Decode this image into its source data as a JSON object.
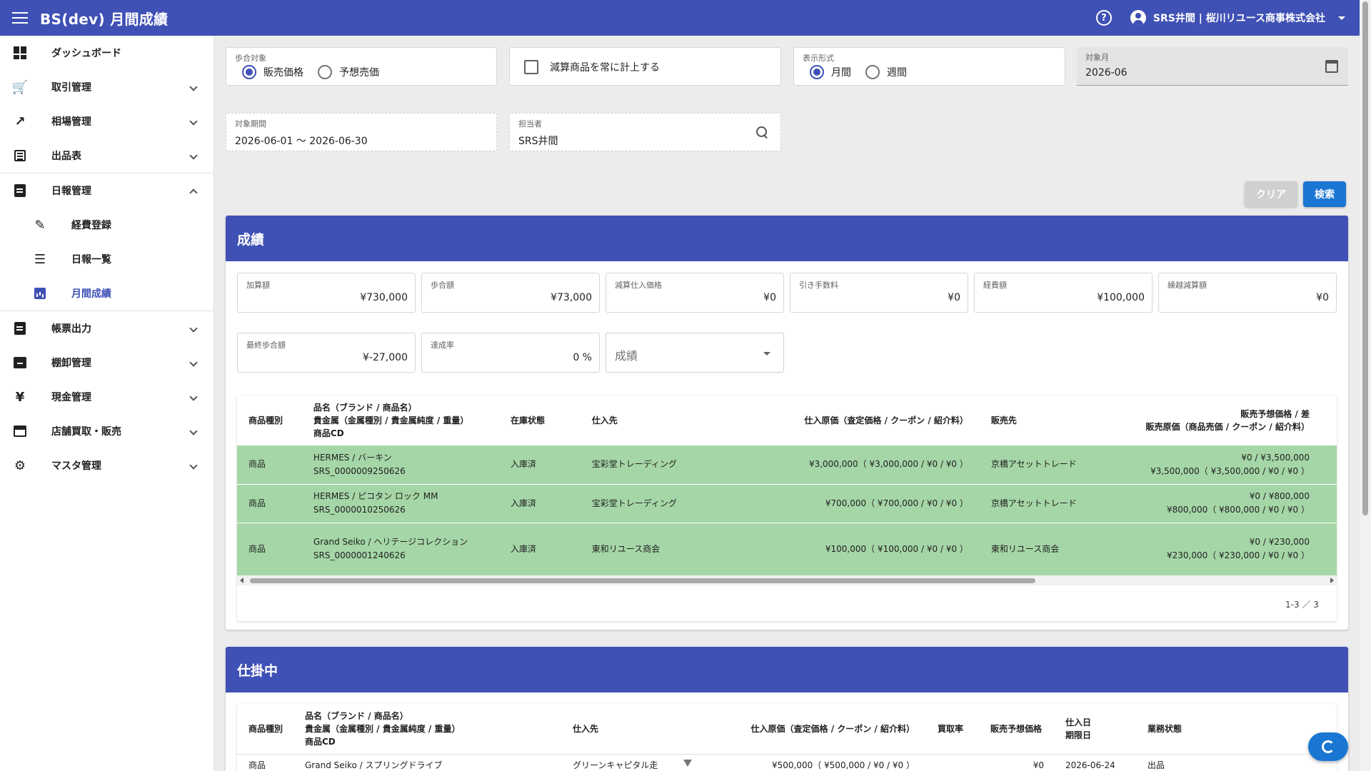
{
  "app": {
    "title": "BS(dev) 月間成績",
    "user": "SRS井間 | 桜川リユース商事株式会社"
  },
  "sidebar": {
    "items": [
      {
        "label": "ダッシュボード",
        "icon": "dashboard-icon"
      },
      {
        "label": "取引管理",
        "icon": "cart-icon"
      },
      {
        "label": "相場管理",
        "icon": "trending-icon"
      },
      {
        "label": "出品表",
        "icon": "list-icon"
      },
      {
        "label": "日報管理",
        "icon": "report-icon"
      },
      {
        "label": "帳票出力",
        "icon": "form-icon"
      },
      {
        "label": "棚卸管理",
        "icon": "inventory-icon"
      },
      {
        "label": "現金管理",
        "icon": "yen-icon"
      },
      {
        "label": "店舗買取・販売",
        "icon": "store-icon"
      },
      {
        "label": "マスタ管理",
        "icon": "gear-icon"
      }
    ],
    "sub_items": [
      {
        "label": "経費登録",
        "icon": "edit-note-icon"
      },
      {
        "label": "日報一覧",
        "icon": "list-bullet-icon"
      },
      {
        "label": "月間成績",
        "icon": "bar-chart-icon"
      }
    ],
    "yen_glyph": "¥"
  },
  "filters": {
    "rate_target": {
      "label": "歩合対象",
      "options": [
        "販売価格",
        "予想売価"
      ],
      "selected": "販売価格"
    },
    "deduct_checkbox": {
      "label": "減算商品を常に計上する",
      "checked": false
    },
    "display_format": {
      "label": "表示形式",
      "options": [
        "月間",
        "週間"
      ],
      "selected": "月間"
    },
    "target_month": {
      "label": "対象月",
      "value": "2026-06"
    },
    "period": {
      "label": "対象期間",
      "value": "2026-06-01 ～ 2026-06-30"
    },
    "assignee": {
      "label": "担当者",
      "value": "SRS井間"
    },
    "clear_label": "クリア",
    "search_label": "検索"
  },
  "results": {
    "title": "成績",
    "metrics": [
      {
        "label": "加算額",
        "value": "¥730,000"
      },
      {
        "label": "歩合額",
        "value": "¥73,000"
      },
      {
        "label": "減算仕入価格",
        "value": "¥0"
      },
      {
        "label": "引き手数料",
        "value": "¥0"
      },
      {
        "label": "経費額",
        "value": "¥100,000"
      },
      {
        "label": "繰越減算額",
        "value": "¥0"
      },
      {
        "label": "最終歩合額",
        "value": "¥-27,000"
      },
      {
        "label": "達成率",
        "value": "0 %"
      }
    ],
    "select_value": "成績",
    "table": {
      "headers": {
        "type": "商品種別",
        "name": [
          "品名（ブランド / 商品名）",
          "貴金属（金属種別 / 貴金属純度 / 重量）",
          "商品CD"
        ],
        "stock": "在庫状態",
        "supplier": "仕入先",
        "cost": "仕入原価（査定価格 / クーポン / 紹介料）",
        "buyer": "販売先",
        "sale": [
          "販売予想価格 / 差",
          "販売原価（商品売価 / クーポン / 紹介料）"
        ]
      },
      "rows": [
        {
          "type": "商品",
          "name": "HERMES / バーキン",
          "code": "SRS_0000009250626",
          "stock": "入庫済",
          "supplier": "宝彩堂トレーディング",
          "cost": "¥3,000,000（ ¥3,000,000 / ¥0 / ¥0 ）",
          "buyer": "京橋アセットトレード",
          "sale1": "¥0 / ¥3,500,000",
          "sale2": "¥3,500,000（ ¥3,500,000 / ¥0 / ¥0 ）"
        },
        {
          "type": "商品",
          "name": "HERMES / ピコタン ロック MM",
          "code": "SRS_0000010250626",
          "stock": "入庫済",
          "supplier": "宝彩堂トレーディング",
          "cost": "¥700,000（ ¥700,000 / ¥0 / ¥0 ）",
          "buyer": "京橋アセットトレード",
          "sale1": "¥0 / ¥800,000",
          "sale2": "¥800,000（ ¥800,000 / ¥0 / ¥0 ）"
        },
        {
          "type": "商品",
          "name": "Grand Seiko / ヘリテージコレクション",
          "code": "SRS_0000001240626",
          "stock": "入庫済",
          "supplier": "東和リユース商会",
          "cost": "¥100,000（ ¥100,000 / ¥0 / ¥0 ）",
          "buyer": "東和リユース商会",
          "sale1": "¥0 / ¥230,000",
          "sale2": "¥230,000（ ¥230,000 / ¥0 / ¥0 ）"
        }
      ],
      "pager": "1-3 ／ 3"
    }
  },
  "in_progress": {
    "title": "仕掛中",
    "headers": {
      "type": "商品種別",
      "name": [
        "品名（ブランド / 商品名）",
        "貴金属（金属種別 / 貴金属純度 / 重量）",
        "商品CD"
      ],
      "supplier": "仕入先",
      "cost": "仕入原価（査定価格 / クーポン / 紹介料）",
      "rate": "買取率",
      "expected": "販売予想価格",
      "date": [
        "仕入日",
        "期限日"
      ],
      "status": "業務状態"
    },
    "row": {
      "type": "商品",
      "name": "Grand Seiko / スプリングドライブ",
      "supplier": "グリーンキャピタル走",
      "cost": "¥500,000（ ¥500,000 / ¥0 / ¥0 ）",
      "expected": "¥0",
      "date": "2026-06-24",
      "status": "出品"
    }
  },
  "colors": {
    "primary": "#3f51b5",
    "accent_button": "#1976d2",
    "row_highlight": "#a5d6a7"
  }
}
